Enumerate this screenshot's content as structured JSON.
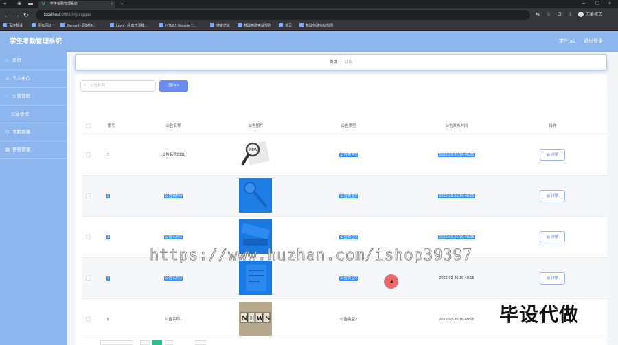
{
  "browser": {
    "tab_title": "学生考勤管理系统",
    "url_host": "localhost",
    "url_rest": ":8081/#/gonggao",
    "profile_label": "无痕模式",
    "bookmarks": [
      "百度翻译",
      "图标网站",
      "Element - 网站快...",
      "Layui - 经典开源模...",
      "HTML5 Website T...",
      "搜索壁纸",
      "基础构建实战规则",
      "首页",
      "基础构建实战规则"
    ]
  },
  "app": {
    "title": "学生考勤管理系统",
    "user_label": "学生 a1",
    "logout_label": "退出登录"
  },
  "sidebar": {
    "items": [
      {
        "label": "首页",
        "icon": "home-icon"
      },
      {
        "label": "个人中心",
        "icon": "user-icon"
      },
      {
        "label": "公告管理",
        "icon": "notice-icon"
      },
      {
        "label": "公告管理",
        "icon": ""
      },
      {
        "label": "考勤管理",
        "icon": "clock-icon"
      },
      {
        "label": "预警管理",
        "icon": "warning-icon"
      }
    ]
  },
  "breadcrumb": {
    "home": "首页",
    "sep": "/",
    "current": "公告"
  },
  "search": {
    "placeholder": "公告标题",
    "button_label": "查询"
  },
  "table": {
    "headers": [
      "索引",
      "公告名称",
      "公告图片",
      "公告类型",
      "公告发布时间",
      "操作"
    ],
    "rows": [
      {
        "index": "1",
        "name": "公告名称5111",
        "type": "公告类型2",
        "time": "2022-03-26 16:49:15",
        "action": "详情",
        "img": "paper"
      },
      {
        "index": "2",
        "name": "公告名称4",
        "type": "公告类型2",
        "time": "2022-03-26 16:49:15",
        "action": "详情",
        "img": "blue-magnifier"
      },
      {
        "index": "3",
        "name": "公告名称3",
        "type": "公告类型2",
        "time": "2022-03-26 16:49:15",
        "action": "详情",
        "img": "blue-news"
      },
      {
        "index": "4",
        "name": "公告名称2",
        "type": "公告类型2",
        "time": "2022-03-26 16:49:15",
        "action": "详情",
        "img": "blue-paper"
      },
      {
        "index": "5",
        "name": "公告名称1",
        "type": "公告类型2",
        "time": "2022-03-26 16:49:15",
        "action": "详情",
        "img": "news-blocks"
      }
    ]
  },
  "overlays": {
    "watermark": "https://www.huzhan.com/ishop39397",
    "promo": "毕设代做"
  },
  "colors": {
    "accent": "#8eb6ee",
    "primary_button": "#6b8cf0",
    "selection": "#3390ff"
  }
}
